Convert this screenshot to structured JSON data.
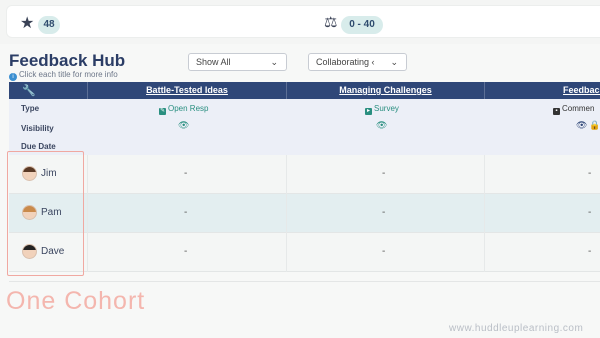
{
  "topbar": {
    "star_count": "48",
    "range": "0 - 40"
  },
  "hub": {
    "title": "Feedback Hub",
    "hint": "Click each title for more info"
  },
  "filters": {
    "show": "Show All",
    "mode": "Collaborating ‹"
  },
  "columns": [
    {
      "title": "Battle-Tested Ideas",
      "type": "Open Resp"
    },
    {
      "title": "Managing Challenges",
      "type": "Survey"
    },
    {
      "title": "Feedback &",
      "type": "Commen"
    }
  ],
  "meta_labels": {
    "type": "Type",
    "visibility": "Visibility",
    "due": "Due Date"
  },
  "people": [
    {
      "name": "Jim",
      "values": [
        "-",
        "-",
        "-"
      ]
    },
    {
      "name": "Pam",
      "values": [
        "-",
        "-",
        "-"
      ]
    },
    {
      "name": "Dave",
      "values": [
        "-",
        "-",
        "-"
      ]
    }
  ],
  "caption": "One Cohort",
  "watermark": "www.huddleuplearning.com",
  "colors": {
    "header": "#2f4778",
    "accent": "#2a8f80",
    "highlight": "#f0a8a1"
  },
  "icons": [
    "star-icon",
    "scale-icon",
    "wrench-icon",
    "info-icon",
    "chevron-down-icon",
    "eye-icon",
    "lock-icon"
  ]
}
